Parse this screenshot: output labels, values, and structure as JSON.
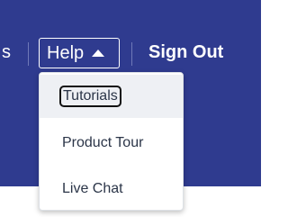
{
  "nav": {
    "previous_item_fragment": "s",
    "help_label": "Help",
    "help_caret_icon": "caret-up-icon",
    "sign_out_label": "Sign Out",
    "background_color": "#2f3b8f"
  },
  "help_menu": {
    "items": [
      {
        "label": "Tutorials",
        "state": "focused"
      },
      {
        "label": "Product Tour",
        "state": "normal"
      },
      {
        "label": "Live Chat",
        "state": "normal"
      }
    ]
  }
}
